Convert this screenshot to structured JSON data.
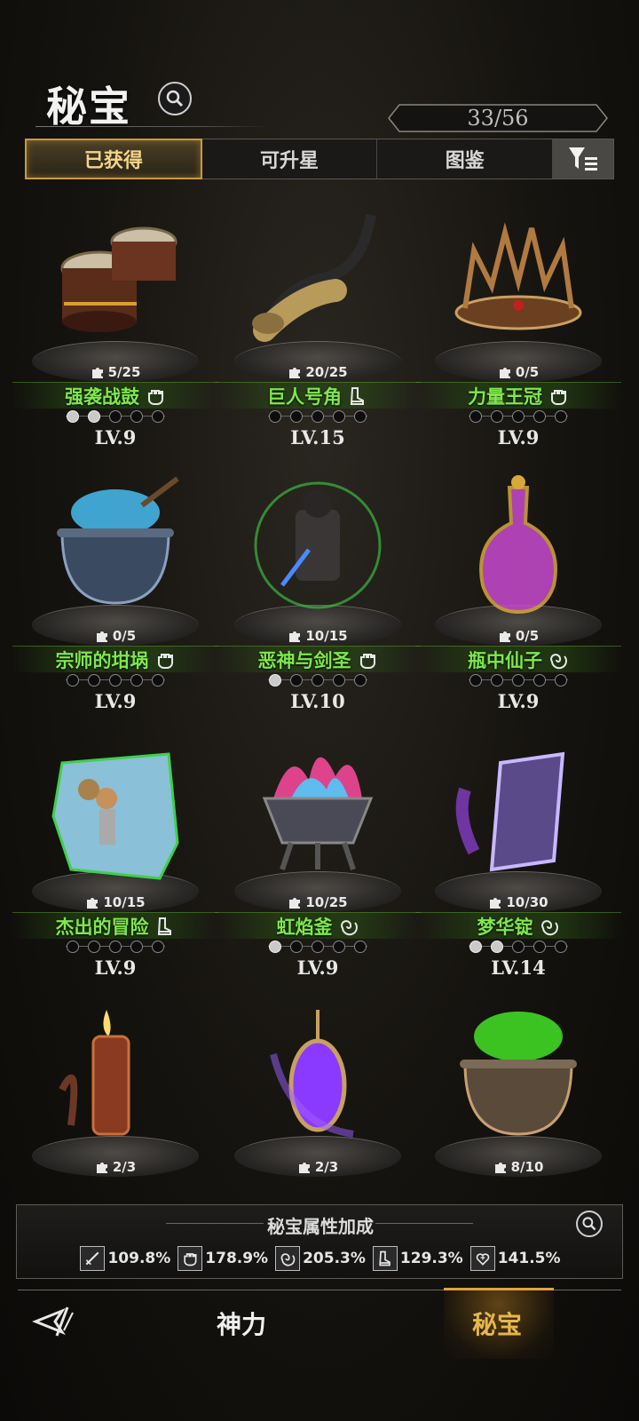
{
  "header": {
    "title": "秘宝",
    "counter": "33/56"
  },
  "tabs": [
    {
      "label": "已获得",
      "active": true
    },
    {
      "label": "可升星",
      "active": false
    },
    {
      "label": "图鉴",
      "active": false
    }
  ],
  "items": [
    {
      "name": "强袭战鼓",
      "shards": "5/25",
      "level": "LV.9",
      "stars": 2,
      "type_icon": "fist-icon",
      "art_icon": "drum-icon"
    },
    {
      "name": "巨人号角",
      "shards": "20/25",
      "level": "LV.15",
      "stars": 0,
      "type_icon": "boot-icon",
      "art_icon": "horn-icon"
    },
    {
      "name": "力量王冠",
      "shards": "0/5",
      "level": "LV.9",
      "stars": 0,
      "type_icon": "fist-icon",
      "art_icon": "crown-icon"
    },
    {
      "name": "宗师的坩埚",
      "shards": "0/5",
      "level": "LV.9",
      "stars": 0,
      "type_icon": "fist-icon",
      "art_icon": "cauldron-blue-icon"
    },
    {
      "name": "恶神与剑圣",
      "shards": "10/15",
      "level": "LV.10",
      "stars": 1,
      "type_icon": "fist-icon",
      "art_icon": "warrior-icon"
    },
    {
      "name": "瓶中仙子",
      "shards": "0/5",
      "level": "LV.9",
      "stars": 0,
      "type_icon": "swirl-icon",
      "art_icon": "bottle-icon"
    },
    {
      "name": "杰出的冒险",
      "shards": "10/15",
      "level": "LV.9",
      "stars": 0,
      "type_icon": "boot-icon",
      "art_icon": "adventurer-icon"
    },
    {
      "name": "虹焰釜",
      "shards": "10/25",
      "level": "LV.9",
      "stars": 1,
      "type_icon": "swirl-icon",
      "art_icon": "rainbow-brazier-icon"
    },
    {
      "name": "梦华锭",
      "shards": "10/30",
      "level": "LV.14",
      "stars": 2,
      "type_icon": "swirl-icon",
      "art_icon": "ingot-icon"
    },
    {
      "name": "",
      "shards": "2/3",
      "level": "",
      "art_icon": "candle-icon"
    },
    {
      "name": "",
      "shards": "2/3",
      "level": "",
      "art_icon": "lantern-icon"
    },
    {
      "name": "",
      "shards": "8/10",
      "level": "",
      "art_icon": "cauldron-green-icon"
    }
  ],
  "bonus": {
    "title": "秘宝属性加成",
    "stats": [
      {
        "icon": "sword-icon",
        "value": "109.8%"
      },
      {
        "icon": "fist-icon",
        "value": "178.9%"
      },
      {
        "icon": "swirl-icon",
        "value": "205.3%"
      },
      {
        "icon": "boot-icon",
        "value": "129.3%"
      },
      {
        "icon": "heart-icon",
        "value": "141.5%"
      }
    ]
  },
  "nav": {
    "power": "神力",
    "secret": "秘宝"
  },
  "colors": {
    "accent_gold": "#e7b64c",
    "name_green": "#7ee84a"
  }
}
